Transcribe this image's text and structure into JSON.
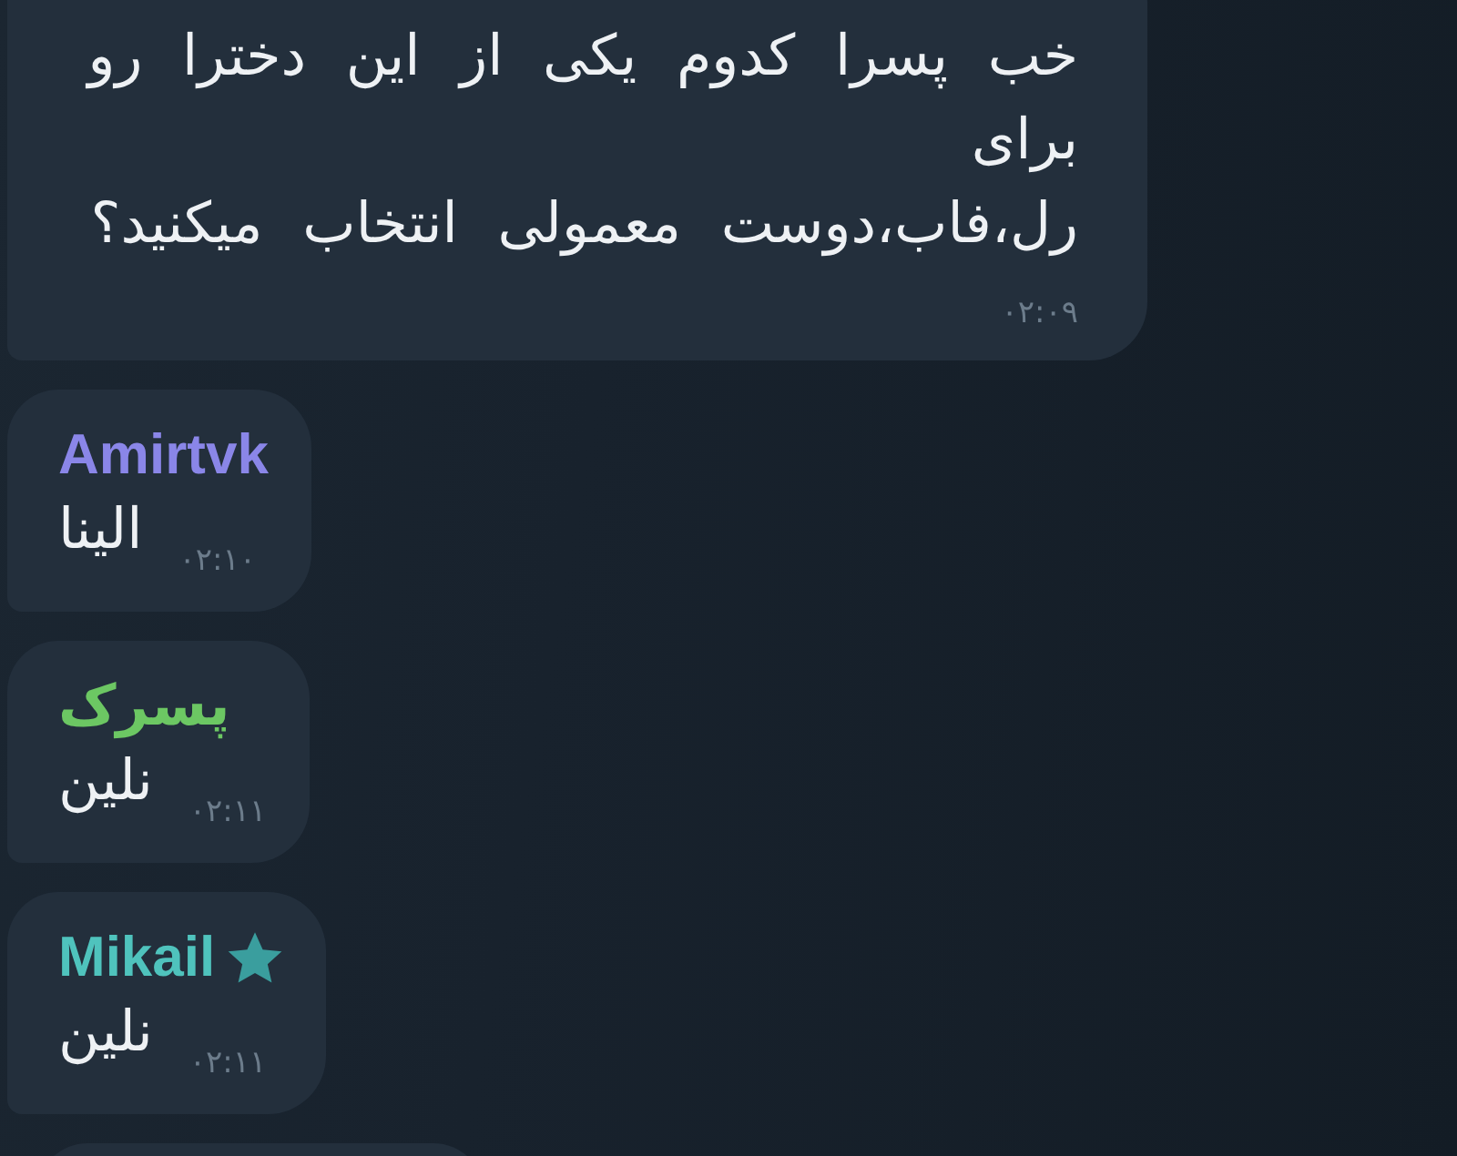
{
  "messages": [
    {
      "kind": "text",
      "text": "خب پسرا کدوم یکی از این دخترا رو\nبرای\nرل،فاب،دوست معمولی انتخاب میکنید؟",
      "time": "۰۲:۰۹"
    },
    {
      "kind": "named",
      "sender": {
        "name": "Amirtvk",
        "color": "#8a86e8",
        "star": false
      },
      "text": "الینا",
      "time": "۰۲:۱۰"
    },
    {
      "kind": "named",
      "sender": {
        "name": "پسرک",
        "color": "#6cc763",
        "star": false
      },
      "text": "نلین",
      "time": "۰۲:۱۱"
    },
    {
      "kind": "named",
      "sender": {
        "name": "Mikail",
        "color": "#4fc3bd",
        "star": true
      },
      "text": "نلین",
      "time": "۰۲:۱۱"
    },
    {
      "kind": "partial"
    }
  ]
}
